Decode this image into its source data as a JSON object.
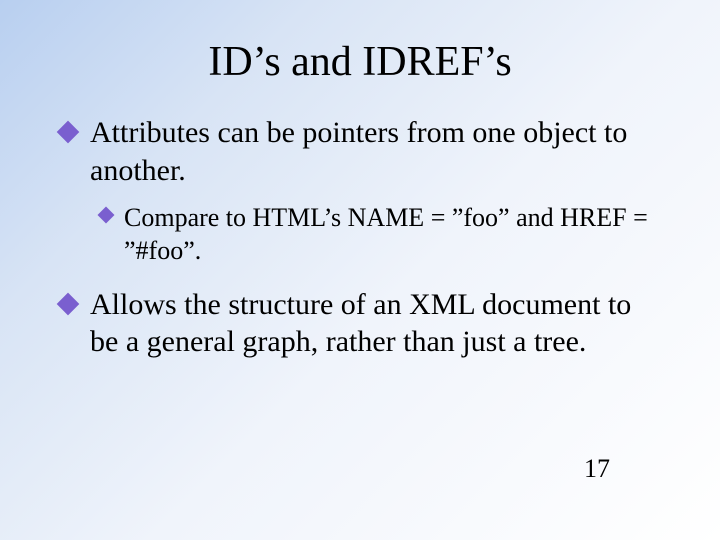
{
  "slide": {
    "title": "ID’s and IDREF’s",
    "bullets": [
      {
        "text": "Attributes can be pointers from one object to another.",
        "sub": [
          "Compare to HTML’s NAME = ”foo” and HREF = ”#foo”."
        ]
      },
      {
        "text": "Allows the structure of an XML document to be a general graph, rather than just a tree.",
        "sub": []
      }
    ],
    "page_number": "17"
  }
}
